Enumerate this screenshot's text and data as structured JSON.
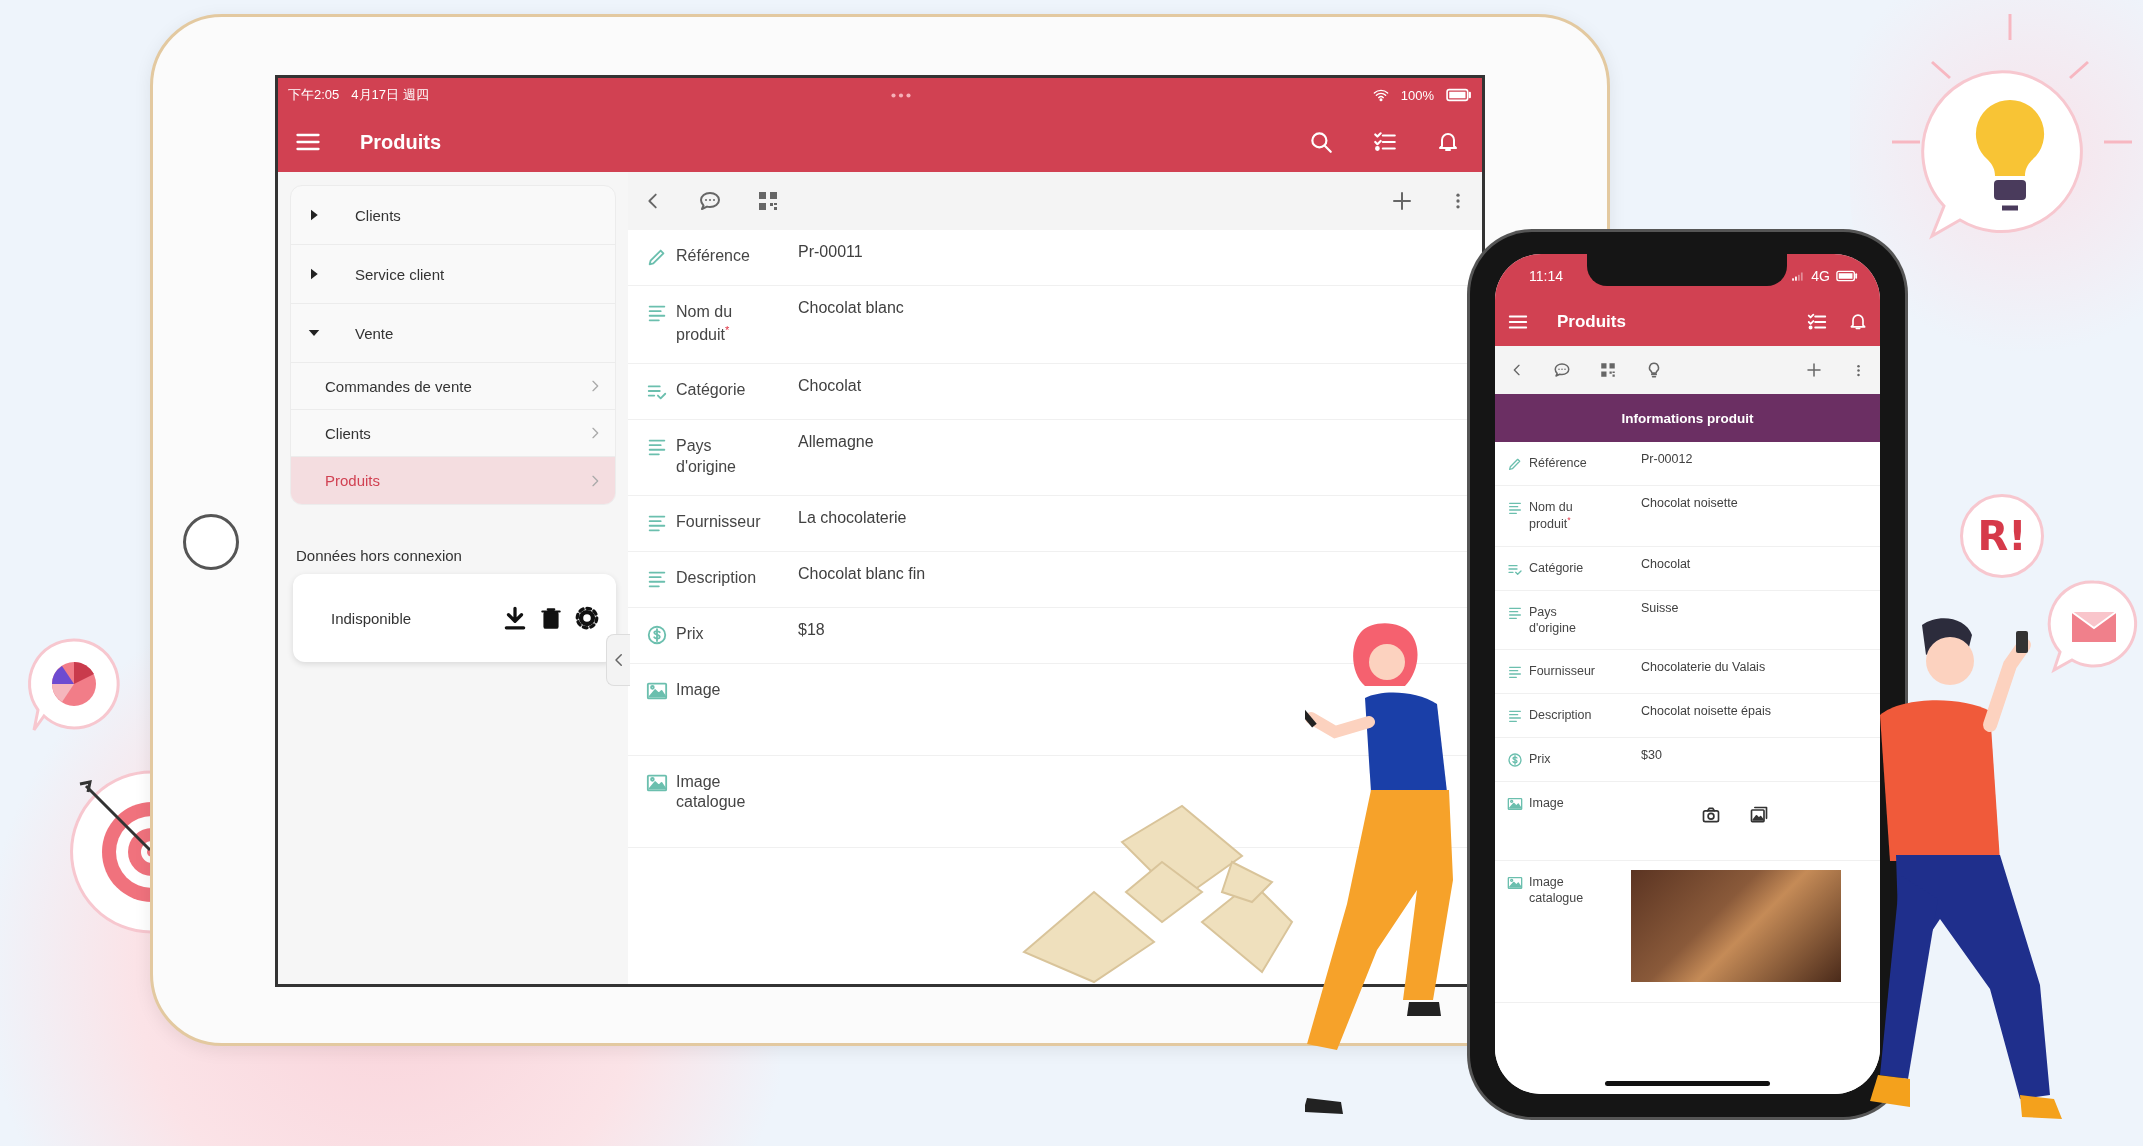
{
  "tablet": {
    "status_bar": {
      "time": "下午2:05",
      "date": "4月17日 週四",
      "battery": "100%"
    },
    "app_bar": {
      "title": "Produits"
    },
    "sidebar": {
      "items": [
        {
          "label": "Clients",
          "expanded": false,
          "selected": false
        },
        {
          "label": "Service client",
          "expanded": false,
          "selected": false
        },
        {
          "label": "Vente",
          "expanded": true,
          "selected": false,
          "children": [
            {
              "label": "Commandes de vente",
              "selected": false
            },
            {
              "label": "Clients",
              "selected": false
            },
            {
              "label": "Produits",
              "selected": true
            }
          ]
        }
      ],
      "offline": {
        "title": "Données hors connexion",
        "status": "Indisponible"
      }
    },
    "record": {
      "fields": [
        {
          "kind": "reference",
          "label": "Référence",
          "value": "Pr-00011"
        },
        {
          "kind": "text",
          "label": "Nom du produit$^{*}$",
          "value": "Chocolat blanc"
        },
        {
          "kind": "choice",
          "label": "Catégorie",
          "value": "Chocolat"
        },
        {
          "kind": "text",
          "label": "Pays d'origine",
          "value": "Allemagne"
        },
        {
          "kind": "text",
          "label": "Fournisseur",
          "value": "La chocolaterie"
        },
        {
          "kind": "text",
          "label": "Description",
          "value": "Chocolat blanc fin"
        },
        {
          "kind": "money",
          "label": "Prix",
          "value": "$18"
        },
        {
          "kind": "image",
          "label": "Image"
        },
        {
          "kind": "image",
          "label": "Image catalogue"
        }
      ]
    }
  },
  "phone": {
    "status_bar": {
      "time": "11:14",
      "network": "4G"
    },
    "app_bar": {
      "title": "Produits"
    },
    "record": {
      "section": "Informations produit",
      "fields": [
        {
          "kind": "reference",
          "label": "Référence",
          "value": "Pr-00012"
        },
        {
          "kind": "text",
          "label": "Nom du produit$^{*}$",
          "value": "Chocolat noisette"
        },
        {
          "kind": "choice",
          "label": "Catégorie",
          "value": "Chocolat"
        },
        {
          "kind": "text",
          "label": "Pays d'origine",
          "value": "Suisse"
        },
        {
          "kind": "text",
          "label": "Fournisseur",
          "value": "Chocolaterie du Valais"
        },
        {
          "kind": "text",
          "label": "Description",
          "value": "Chocolat noisette épais"
        },
        {
          "kind": "money",
          "label": "Prix",
          "value": "$30"
        },
        {
          "kind": "image-upload",
          "label": "Image"
        },
        {
          "kind": "image-photo",
          "label": "Image catalogue"
        }
      ]
    }
  },
  "badge": {
    "text": "R!"
  }
}
